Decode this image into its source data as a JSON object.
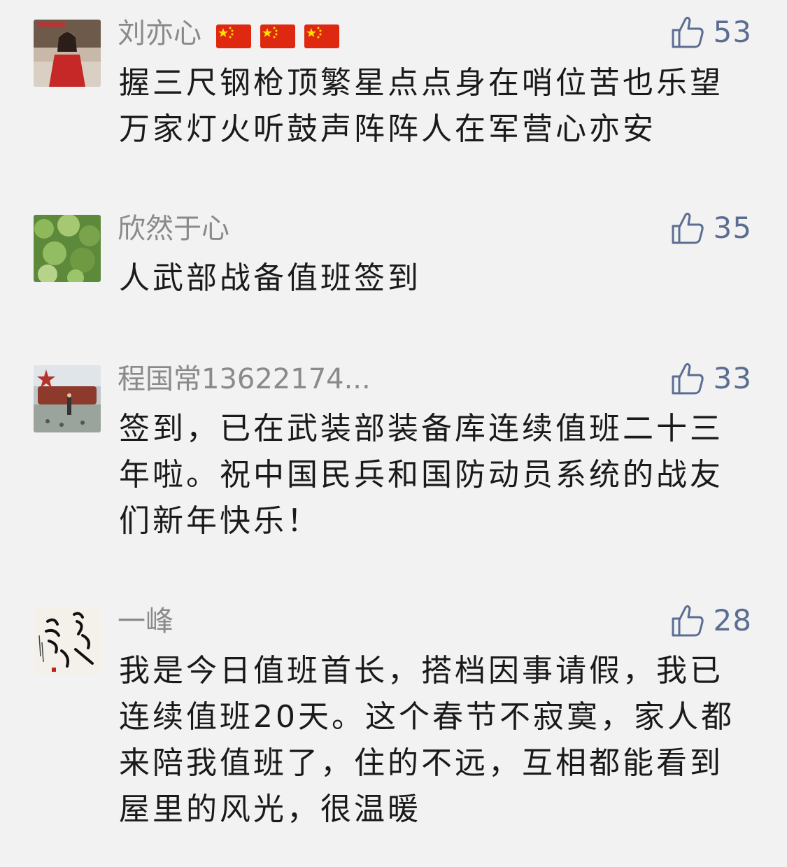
{
  "comments": [
    {
      "name": "刘亦心",
      "flags": [
        "🇨🇳",
        "🇨🇳",
        "🇨🇳"
      ],
      "likes": "53",
      "text": "握三尺钢枪顶繁星点点身在哨位苦也乐望万家灯火听鼓声阵阵人在军营心亦安"
    },
    {
      "name": "欣然于心",
      "likes": "35",
      "text": "人武部战备值班签到"
    },
    {
      "name": "程国常13622174...",
      "likes": "33",
      "text": "签到，已在武装部装备库连续值班二十三年啦。祝中国民兵和国防动员系统的战友们新年快乐！"
    },
    {
      "name": "一峰",
      "likes": "28",
      "text": "我是今日值班首长，搭档因事请假，我已连续值班20天。这个春节不寂寞，家人都来陪我值班了，住的不远，互相都能看到屋里的风光，很温暖"
    }
  ],
  "colors": {
    "background": "#f2f2f2",
    "name": "#8a8a8a",
    "like": "#5b6d91",
    "text": "#1a1a1a"
  },
  "icons": {
    "like": "thumbs-up-icon",
    "flag": "china-flag-icon"
  }
}
